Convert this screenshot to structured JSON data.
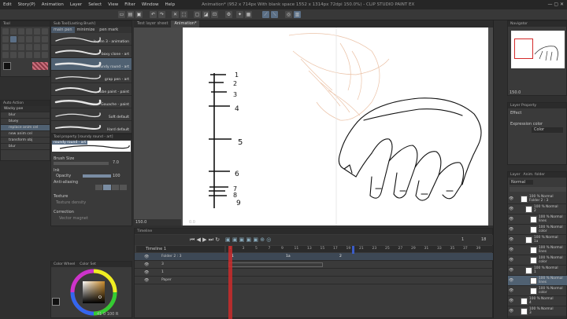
{
  "menu": [
    "Edit",
    "Story(P)",
    "Animation",
    "Layer",
    "Select",
    "View",
    "Filter",
    "Window",
    "Help"
  ],
  "window_title": "Animation* (952 x 714px With blank space 1552 x 1314px 72dpi 150.0%) - CLIP STUDIO PAINT EX",
  "doc_tabs": [
    "Test layer sheet",
    "Animation*"
  ],
  "tool_tab": "Tool",
  "sub_tool_header": "Sub Tool[Lasting Brush]",
  "brush_tabs": [
    "main pen",
    "minimize",
    "pen mark"
  ],
  "brushes": [
    "le pen 3 - animation",
    "boxy clone - art",
    "roundy round - art",
    "grap pen - art",
    "cube paint - paint",
    "Gouache - paint",
    "Soft default",
    "Hard default"
  ],
  "selected_brush_index": 2,
  "auto_action_header": "Auto Action",
  "auto_action_set": "Wacky poe",
  "auto_actions": [
    "blur",
    "bluey",
    "replace anim cel",
    "new anim cel",
    "transform obj",
    "blur"
  ],
  "selected_action_index": 2,
  "tool_property_header": "Tool property [roundy round - art]",
  "tool_property_name": "roundy round - art",
  "props": {
    "brush_size_label": "Brush Size",
    "brush_size": "7.0",
    "ink_label": "Ink",
    "opacity_label": "Opacity",
    "opacity": "100",
    "anti_aliasing_label": "Anti-aliasing",
    "texture_label": "Texture",
    "texture_density_label": "Texture density",
    "correction_label": "Correction",
    "vector_magnet_label": "Vector magnet"
  },
  "color_tabs": [
    "Color Wheel",
    "Color Set"
  ],
  "color_bottom_text": "41  0  100  R",
  "zoom": "150.0",
  "rotation": "0.0",
  "timeline_header": "Timeline",
  "timeline_name": "Timeline 1",
  "frame_numbers": [
    "1",
    "3",
    "5",
    "7",
    "9",
    "11",
    "13",
    "15",
    "17",
    "19",
    "21",
    "23",
    "25",
    "27",
    "29",
    "31",
    "33",
    "35",
    "37",
    "39"
  ],
  "current_frame": "1",
  "end_frame": "18",
  "tracks": [
    {
      "name": "Folder 2 : 3",
      "cels": [
        "1",
        "1a",
        "2"
      ]
    },
    {
      "name": "3",
      "cels": []
    },
    {
      "name": "1",
      "cels": []
    },
    {
      "name": "Paper",
      "cels": []
    }
  ],
  "navigator_header": "Navigator",
  "navigator_zoom": "150.0",
  "layer_property_header": "Layer Property",
  "effect_label": "Effect",
  "expression_color_label": "Expression color",
  "expression_color": "Color",
  "layer_tabs": [
    "Layer",
    "Anim. folder"
  ],
  "blend_mode": "Normal",
  "layers": [
    {
      "name": "100 % Normal",
      "sub": "Folder 2 : 3",
      "indent": 0
    },
    {
      "name": "100 % Normal",
      "sub": "2",
      "indent": 1
    },
    {
      "name": "100 % Normal",
      "sub": "lines",
      "indent": 2
    },
    {
      "name": "100 % Normal",
      "sub": "color",
      "indent": 2
    },
    {
      "name": "100 % Normal",
      "sub": "1a",
      "indent": 1
    },
    {
      "name": "100 % Normal",
      "sub": "lines",
      "indent": 2
    },
    {
      "name": "100 % Normal",
      "sub": "color",
      "indent": 2
    },
    {
      "name": "100 % Normal",
      "sub": "1",
      "indent": 1
    },
    {
      "name": "100 % Normal",
      "sub": "lines",
      "indent": 2
    },
    {
      "name": "100 % Normal",
      "sub": "color",
      "indent": 2
    },
    {
      "name": "100 % Normal",
      "sub": "4",
      "indent": 0
    },
    {
      "name": "100 % Normal",
      "sub": "3",
      "indent": 0
    }
  ],
  "selected_layer_index": 8,
  "sketch_labels": [
    "1",
    "2",
    "3",
    "4",
    "5",
    "6",
    "7",
    "8",
    "9"
  ],
  "colors": {
    "accent": "#5b6f86",
    "playhead": "#d42a2a",
    "canvas": "#ffffff",
    "onion": "#e8b898"
  }
}
